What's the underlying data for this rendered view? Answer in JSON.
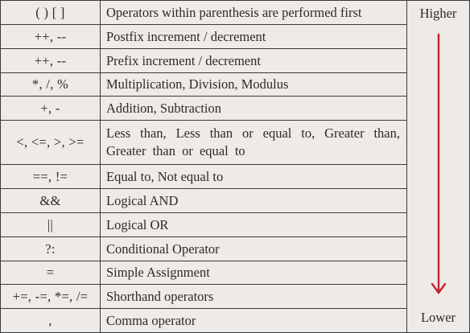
{
  "table": {
    "precedence_high": "Higher",
    "precedence_low": "Lower",
    "arrow_color": "#c0242b",
    "rows": [
      {
        "op": "( ) [ ]",
        "desc": "Operators within parenthesis are performed first"
      },
      {
        "op": "++, --",
        "desc": "Postfix increment / decrement"
      },
      {
        "op": "++, --",
        "desc": "Prefix increment / decrement"
      },
      {
        "op": "*, /, %",
        "desc": "Multiplication, Division, Modulus"
      },
      {
        "op": "+, -",
        "desc": "Addition, Subtraction"
      },
      {
        "op": "<, <=, >, >=",
        "desc_line1": "Less than, Less than or equal to, Greater than,",
        "desc_line2": "Greater than or equal to"
      },
      {
        "op": "==, !=",
        "desc": "Equal to, Not equal to"
      },
      {
        "op": "&&",
        "desc": "Logical AND"
      },
      {
        "op": "||",
        "desc": "Logical OR"
      },
      {
        "op": "?:",
        "desc": "Conditional Operator"
      },
      {
        "op": "=",
        "desc": "Simple Assignment"
      },
      {
        "op": "+=, -=, *=, /=",
        "desc": "Shorthand operators"
      },
      {
        "op": ",",
        "desc": "Comma operator"
      }
    ]
  }
}
